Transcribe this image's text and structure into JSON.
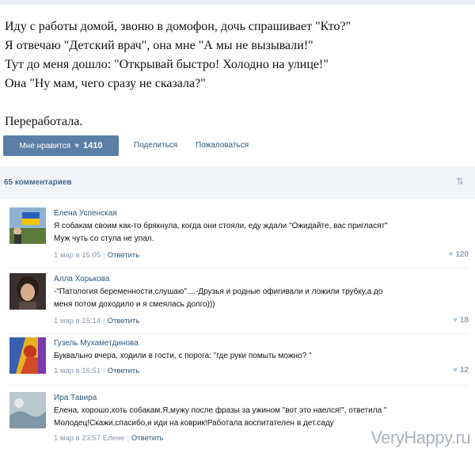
{
  "post": {
    "lines": [
      "Иду с работы домой, звоню в домофон, дочь спрашивает \"Кто?\"",
      "Я отвечаю \"Детский врач\", она мне \"А мы не вызывали!\"",
      "Тут до меня дошло: \"Открывай быстро! Холодно на улице!\"",
      "Она \"Ну мам, чего сразу не сказала?\"",
      "Переработала."
    ]
  },
  "actions": {
    "like_label": "Мне нравится",
    "like_count": "1410",
    "share_label": "Поделиться",
    "report_label": "Пожаловаться"
  },
  "comments_header": {
    "count_label": "65 комментариев",
    "sort_icon": "sort-arrows-icon"
  },
  "comments": [
    {
      "name": "Елена Успенская",
      "text": [
        "Я собакам своим как-то брякнула, когда они стояли, еду ждали \"Ожидайте, вас пригласят\"",
        "Муж чуть со стула не упал."
      ],
      "date": "1 мар в 15:05",
      "reply_label": "Ответить",
      "likes": "120"
    },
    {
      "name": "Алла Хорькова",
      "text": [
        "-\"Патология беременности,слушаю\"....-Друзья и родные офигивали и ложили трубку,а до",
        "меня потом доходило и я смеялась долго)))"
      ],
      "date": "1 мар в 15:14",
      "reply_label": "Ответить",
      "likes": "18"
    },
    {
      "name": "Гузель Мухаметдинова",
      "text": [
        "Буквально вчера, ходили в гости, с порога: \"где руки помыть можно? \""
      ],
      "date": "1 мар в 16:51",
      "reply_label": "Ответить",
      "likes": "12"
    },
    {
      "name": "Ира Тавира",
      "text": [
        "Елена, хорошо,хоть собакам.Я,мужу после фразы за ужином \"вот это наелся!\", ответила \"",
        "Молодец!Скажи,спасибо,и иди на коврик!Работала воспитателен в дет.саду"
      ],
      "date": "1 мар в 23:57 Елене",
      "reply_label": "Ответить",
      "likes": ""
    }
  ],
  "watermark": "VeryHappy.ru",
  "colors": {
    "like_button": "#5b7fa6",
    "link": "#2b587a",
    "meta": "#8a97a6",
    "header_bg": "#f2f4f7"
  }
}
